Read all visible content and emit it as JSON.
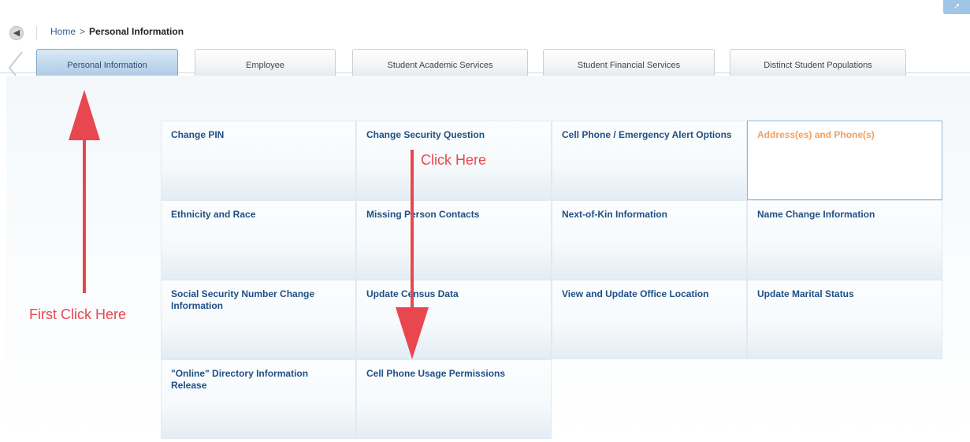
{
  "breadcrumb": {
    "home": "Home",
    "separator": ">",
    "current": "Personal Information"
  },
  "tabs": [
    {
      "label": "Personal Information",
      "active": true
    },
    {
      "label": "Employee",
      "active": false
    },
    {
      "label": "Student Academic Services",
      "active": false
    },
    {
      "label": "Student Financial Services",
      "active": false
    },
    {
      "label": "Distinct Student Populations",
      "active": false
    }
  ],
  "tiles": [
    {
      "label": "Change PIN"
    },
    {
      "label": "Change Security Question"
    },
    {
      "label": "Cell Phone / Emergency Alert Options"
    },
    {
      "label": "Address(es) and Phone(s)",
      "highlighted": true
    },
    {
      "label": "Ethnicity and Race"
    },
    {
      "label": "Missing Person Contacts"
    },
    {
      "label": "Next-of-Kin Information"
    },
    {
      "label": "Name Change Information"
    },
    {
      "label": "Social Security Number Change Information"
    },
    {
      "label": "Update Census Data"
    },
    {
      "label": "View and Update Office Location"
    },
    {
      "label": "Update Marital Status"
    },
    {
      "label": "\"Online\" Directory Information Release"
    },
    {
      "label": "Cell Phone Usage Permissions"
    }
  ],
  "annotations": {
    "first_click": "First Click Here",
    "click_here": "Click Here"
  },
  "colors": {
    "link": "#1f4f86",
    "hover_link": "#f0a060",
    "annotation": "#e8474f",
    "active_tab": "#a6c5e2"
  },
  "icons": {
    "back": "left-arrow-circle-icon",
    "tab_scroll_left": "chevron-left-icon"
  }
}
